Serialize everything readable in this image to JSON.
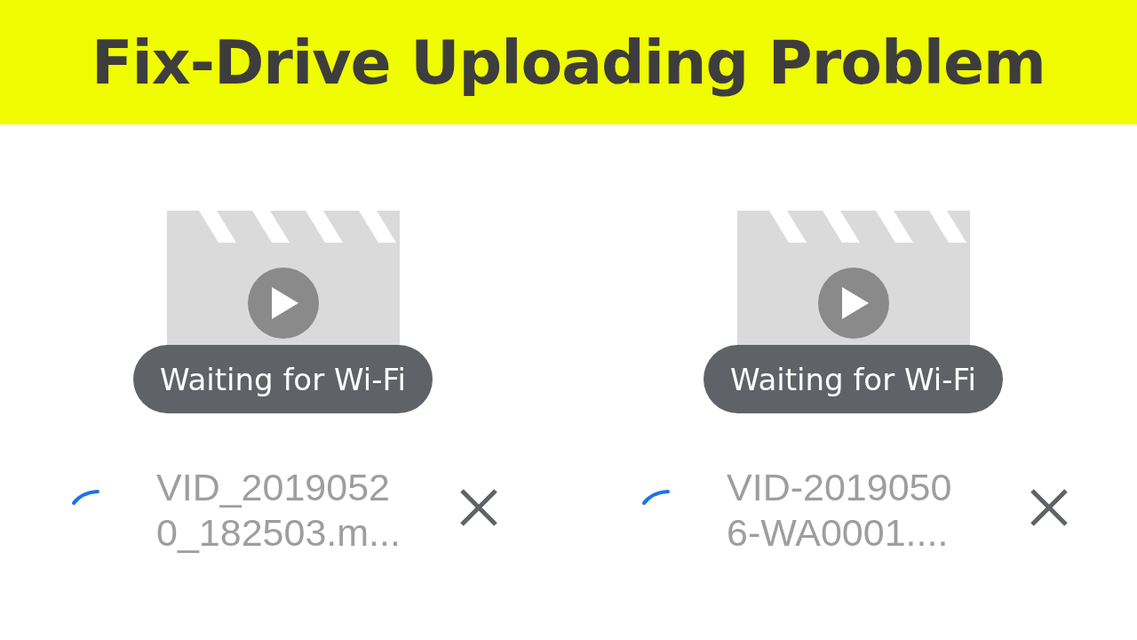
{
  "banner": {
    "title": "Fix-Drive Uploading Problem"
  },
  "uploads": [
    {
      "status": "Waiting for Wi-Fi",
      "file_name_lines": [
        "VID_2019052",
        "0_182503.m..."
      ]
    },
    {
      "status": "Waiting for Wi-Fi",
      "file_name_lines": [
        "VID-2019050",
        "6-WA0001...."
      ]
    }
  ]
}
